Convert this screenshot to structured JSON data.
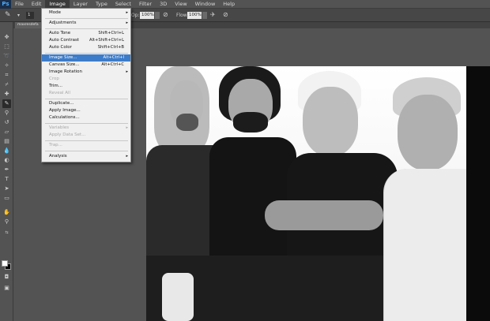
{
  "app": {
    "logo": "Ps"
  },
  "menubar": {
    "items": [
      "File",
      "Edit",
      "Image",
      "Layer",
      "Type",
      "Select",
      "Filter",
      "3D",
      "View",
      "Window",
      "Help"
    ],
    "active": "Image"
  },
  "options": {
    "opacity_label": "Op:",
    "opacity_value": "100%",
    "flow_label": "Flow:",
    "flow_value": "100%"
  },
  "document": {
    "tab_label": "maxresdefa"
  },
  "image_menu": {
    "mode": "Mode",
    "adjustments": "Adjustments",
    "auto_tone": {
      "label": "Auto Tone",
      "shortcut": "Shift+Ctrl+L"
    },
    "auto_contrast": {
      "label": "Auto Contrast",
      "shortcut": "Alt+Shift+Ctrl+L"
    },
    "auto_color": {
      "label": "Auto Color",
      "shortcut": "Shift+Ctrl+B"
    },
    "image_size": {
      "label": "Image Size...",
      "shortcut": "Alt+Ctrl+I"
    },
    "canvas_size": {
      "label": "Canvas Size...",
      "shortcut": "Alt+Ctrl+C"
    },
    "image_rotation": "Image Rotation",
    "crop": "Crop",
    "trim": "Trim...",
    "reveal_all": "Reveal All",
    "duplicate": "Duplicate...",
    "apply_image": "Apply Image...",
    "calculations": "Calculations...",
    "variables": "Variables",
    "apply_data_set": "Apply Data Set...",
    "trap": "Trap...",
    "analysis": "Analysis",
    "submenu_arrow": "▸"
  },
  "colors": {
    "highlight": "#3d7cc9",
    "ui_bg": "#535353",
    "menu_bg": "#f0f0f0"
  }
}
